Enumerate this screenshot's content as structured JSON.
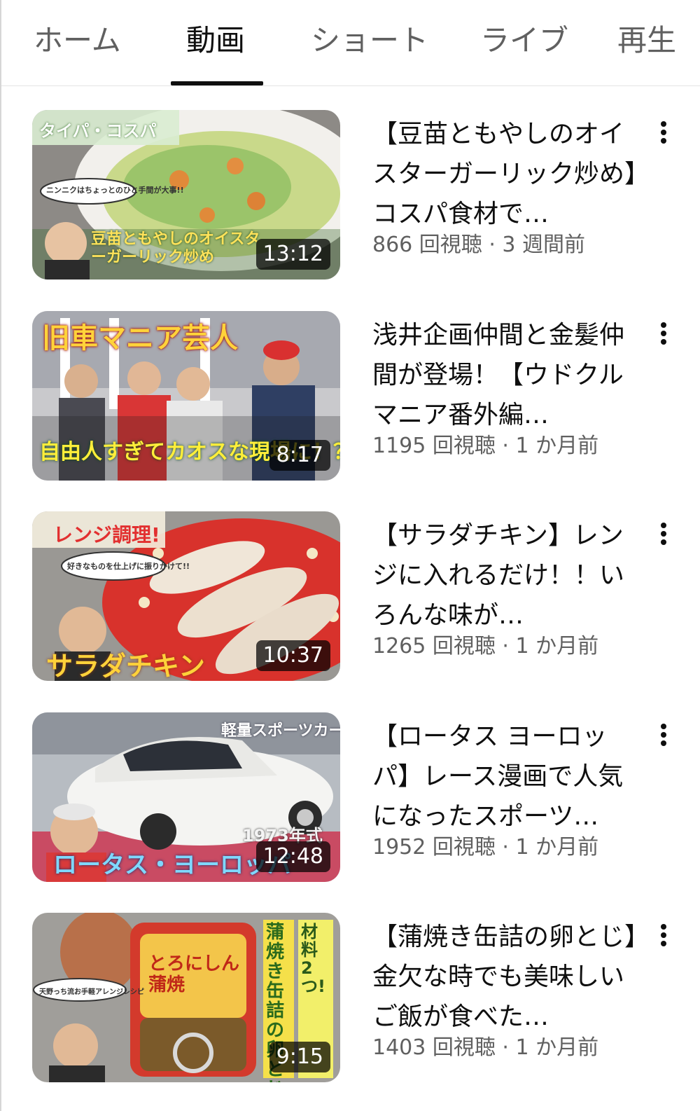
{
  "tabs": [
    {
      "label": "ホーム",
      "active": false
    },
    {
      "label": "動画",
      "active": true
    },
    {
      "label": "ショート",
      "active": false
    },
    {
      "label": "ライブ",
      "active": false
    },
    {
      "label": "再生",
      "active": false
    }
  ],
  "videos": [
    {
      "title": "【豆苗ともやしのオイスターガーリック炒め】コスパ食材で…",
      "meta": "866 回視聴 · 3 週間前",
      "duration": "13:12",
      "thumb_caption": "タイパ・コスパ",
      "thumb_headline": "豆苗ともやしのオイスターガーリック炒め",
      "thumb_bubble": "ニンニクはちょっとのひと手間が大事!!"
    },
    {
      "title": "浅井企画仲間と金髪仲間が登場！【ウドクルマニア番外編…",
      "meta": "1195 回視聴 · 1 か月前",
      "duration": "8:17",
      "thumb_caption": "旧車マニア芸人",
      "thumb_headline": "自由人すぎてカオスな現場に！？"
    },
    {
      "title": "【サラダチキン】レンジに入れるだけ！！いろんな味が…",
      "meta": "1265 回視聴 · 1 か月前",
      "duration": "10:37",
      "thumb_caption": "レンジ調理!",
      "thumb_headline": "サラダチキン",
      "thumb_bubble": "好きなものを仕上げに振りかけて!!"
    },
    {
      "title": "【ロータス ヨーロッパ】レース漫画で人気になったスポーツ…",
      "meta": "1952 回視聴 · 1 か月前",
      "duration": "12:48",
      "thumb_caption": "軽量スポーツカー",
      "thumb_headline": "ロータス・ヨーロッパ",
      "thumb_year": "1973年式"
    },
    {
      "title": "【蒲焼き缶詰の卵とじ】金欠な時でも美味しいご飯が食べた…",
      "meta": "1403 回視聴 · 1 か月前",
      "duration": "9:15",
      "thumb_caption": "材料2つ!",
      "thumb_headline": "蒲焼き缶詰の卵とじ",
      "thumb_can": "とろにしん蒲焼",
      "thumb_bubble": "天野っち流お手軽アレンジレシピ"
    }
  ],
  "colors": {
    "text_primary": "#0f0f0f",
    "text_secondary": "#606060",
    "duration_bg": "#000000"
  },
  "icons": {
    "more": "more-vert-icon"
  }
}
